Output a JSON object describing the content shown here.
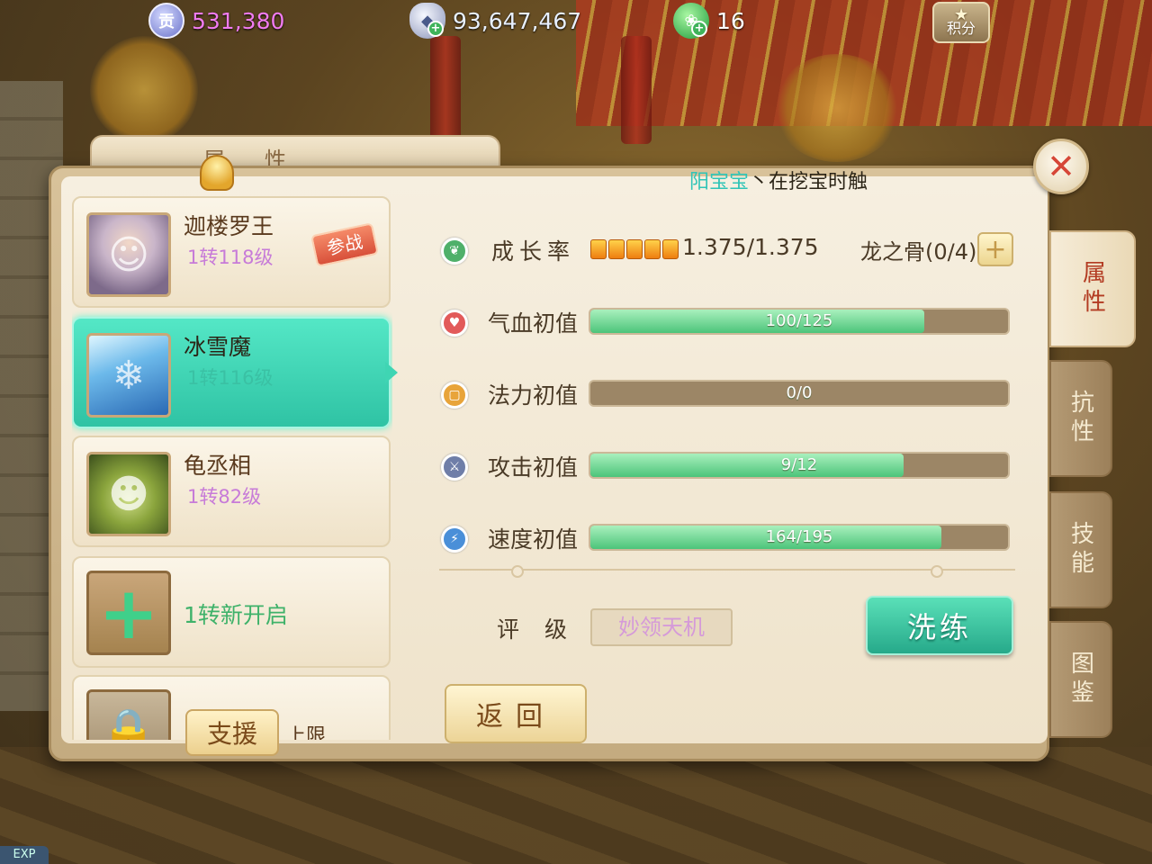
{
  "currency": {
    "contribution": {
      "icon": "contribution-coin-icon",
      "glyph": "贡",
      "value": "531,380"
    },
    "silver": {
      "icon": "silver-ingot-icon",
      "value": "93,647,467"
    },
    "jade": {
      "icon": "jade-icon",
      "value": "16"
    },
    "score": {
      "icon": "score-star-icon",
      "label": "积分"
    }
  },
  "panel": {
    "header_title": "属性",
    "marquee_name": "阳宝宝",
    "marquee_text": "丶在挖宝时触",
    "close_icon": "close-icon"
  },
  "side_tabs": [
    {
      "label": "属性",
      "active": true
    },
    {
      "label": "抗性",
      "active": false
    },
    {
      "label": "技能",
      "active": false
    },
    {
      "label": "图鉴",
      "active": false
    }
  ],
  "pets": [
    {
      "name": "迦楼罗王",
      "level": "1转118级",
      "badge": "参战",
      "portrait": "garuda-portrait"
    },
    {
      "name": "冰雪魔",
      "level": "1转116级",
      "portrait": "ice-demon-portrait",
      "selected": true
    },
    {
      "name": "龟丞相",
      "level": "1转82级",
      "portrait": "turtle-minister-portrait"
    }
  ],
  "add_slot": {
    "label": "1转新开启",
    "icon": "plus-icon"
  },
  "lock_slot": {
    "label": "上限",
    "icon": "lock-icon"
  },
  "support_button": "支援",
  "growth": {
    "label": "成长率",
    "icon": "sprout-icon",
    "pips": 5,
    "value": "1.375/1.375",
    "bone_label": "龙之骨(0/4)",
    "bone_button": "+"
  },
  "attributes": [
    {
      "label": "气血初值",
      "icon": "heart-icon",
      "color": "#e25a5a",
      "text": "100/125",
      "current": 100,
      "max": 125
    },
    {
      "label": "法力初值",
      "icon": "mana-icon",
      "color": "#e8a43a",
      "text": "0/0",
      "current": 0,
      "max": 0
    },
    {
      "label": "攻击初值",
      "icon": "sword-icon",
      "color": "#6f7ea8",
      "text": "9/12",
      "current": 9,
      "max": 12
    },
    {
      "label": "速度初值",
      "icon": "lightning-icon",
      "color": "#4a8fd8",
      "text": "164/195",
      "current": 164,
      "max": 195
    }
  ],
  "rating": {
    "label": "评级",
    "value": "妙领天机"
  },
  "refine_button": "洗练",
  "back_button": "返回",
  "exp_label": "EXP"
}
